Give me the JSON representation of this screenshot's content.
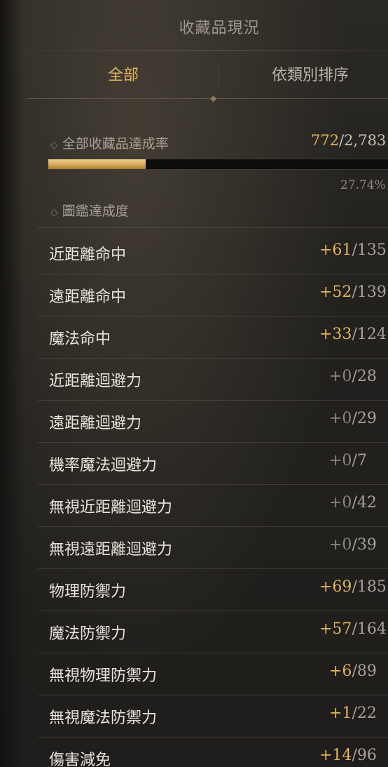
{
  "window": {
    "title": "收藏品現況"
  },
  "tabs": {
    "all": "全部",
    "by_category": "依類別排序"
  },
  "overall": {
    "label": "全部收藏品達成率",
    "current": "772",
    "total": "/2,783",
    "progress_fraction": 0.2774,
    "percent": "27.74%"
  },
  "codex": {
    "label": "圖鑑達成度"
  },
  "colors": {
    "accent": "#e2b45c",
    "text": "#e8e4dc",
    "muted": "#8e887f"
  },
  "stats": [
    {
      "label": "近距離命中",
      "bonus": "+61",
      "max": "/135"
    },
    {
      "label": "遠距離命中",
      "bonus": "+52",
      "max": "/139"
    },
    {
      "label": "魔法命中",
      "bonus": "+33",
      "max": "/124"
    },
    {
      "label": "近距離迴避力",
      "bonus": "+0",
      "max": "/28"
    },
    {
      "label": "遠距離迴避力",
      "bonus": "+0",
      "max": "/29"
    },
    {
      "label": "機率魔法迴避力",
      "bonus": "+0",
      "max": "/7"
    },
    {
      "label": "無視近距離迴避力",
      "bonus": "+0",
      "max": "/42"
    },
    {
      "label": "無視遠距離迴避力",
      "bonus": "+0",
      "max": "/39"
    },
    {
      "label": "物理防禦力",
      "bonus": "+69",
      "max": "/185"
    },
    {
      "label": "魔法防禦力",
      "bonus": "+57",
      "max": "/164"
    },
    {
      "label": "無視物理防禦力",
      "bonus": "+6",
      "max": "/89"
    },
    {
      "label": "無視魔法防禦力",
      "bonus": "+1",
      "max": "/22"
    },
    {
      "label": "傷害減免",
      "bonus": "+14",
      "max": "/96"
    }
  ]
}
